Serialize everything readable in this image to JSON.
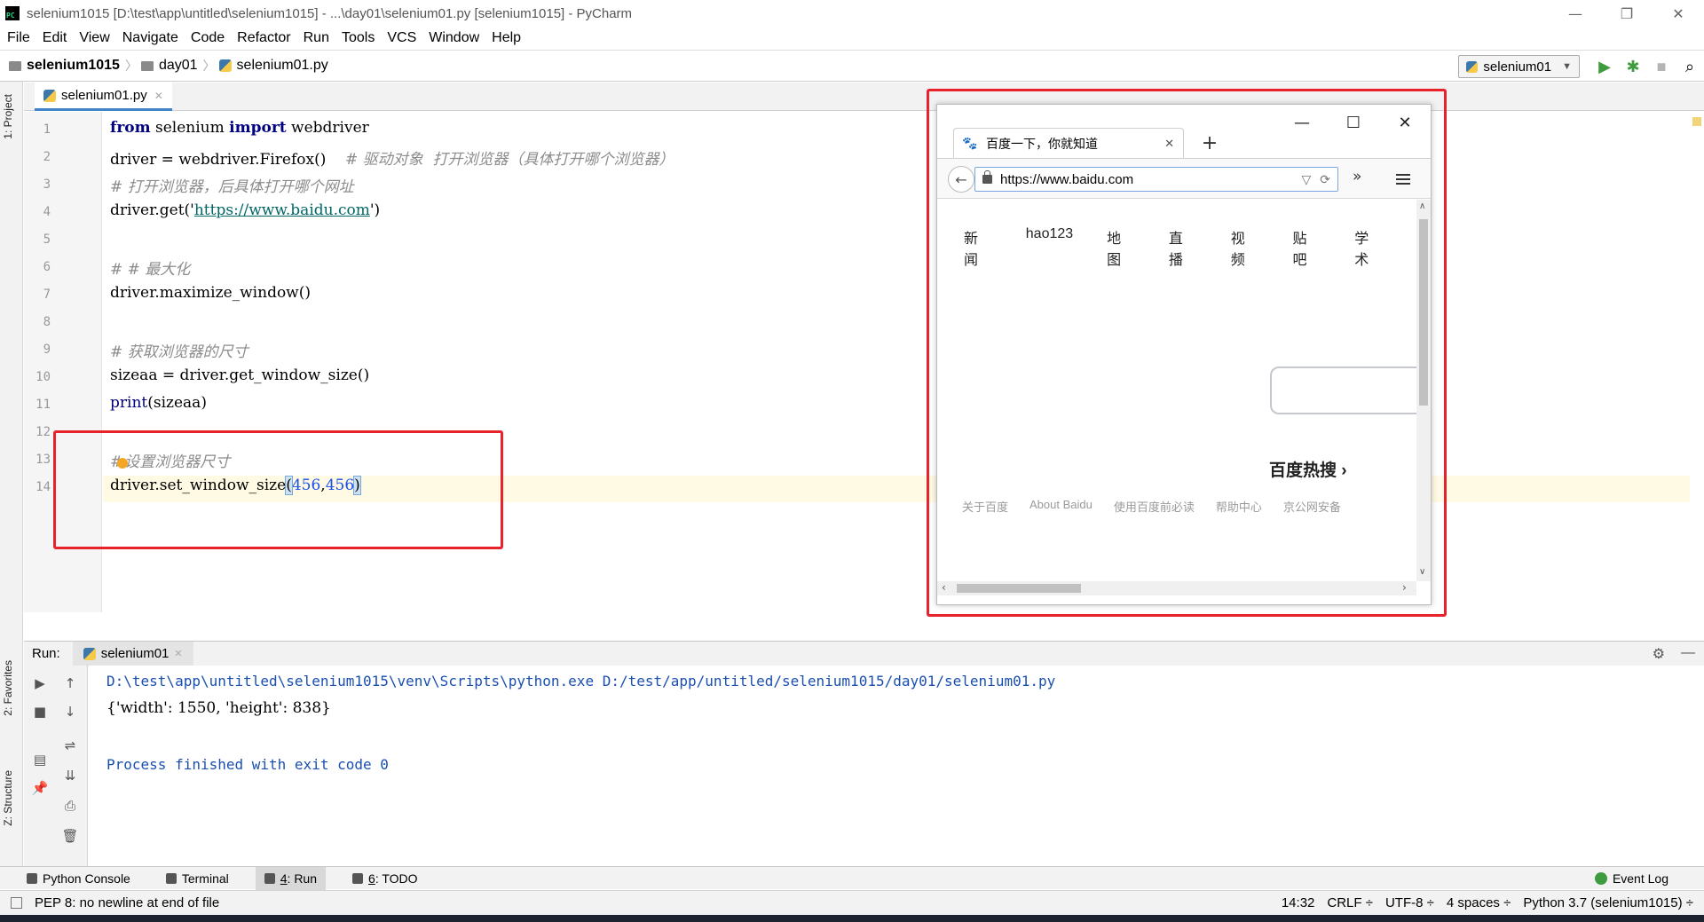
{
  "window": {
    "title": "selenium1015 [D:\\test\\app\\untitled\\selenium1015] - ...\\day01\\selenium01.py [selenium1015] - PyCharm",
    "app_icon_text": "PC",
    "min": "—",
    "max": "❐",
    "close": "✕"
  },
  "menu": [
    "File",
    "Edit",
    "View",
    "Navigate",
    "Code",
    "Refactor",
    "Run",
    "Tools",
    "VCS",
    "Window",
    "Help"
  ],
  "breadcrumb": {
    "project": "selenium1015",
    "folder": "day01",
    "file": "selenium01.py"
  },
  "toolbar": {
    "run_config": "selenium01",
    "run_icon": "▶",
    "debug_icon": "✱",
    "stop_icon": "■",
    "search_icon": "⌕"
  },
  "side_labels": {
    "project": "1: Project",
    "favorites": "2: Favorites",
    "structure": "Z: Structure"
  },
  "editor": {
    "tab_label": "selenium01.py",
    "tab_close": "✕",
    "line_numbers": [
      "1",
      "2",
      "3",
      "4",
      "5",
      "6",
      "7",
      "8",
      "9",
      "10",
      "11",
      "12",
      "13",
      "14"
    ],
    "lines": {
      "l1_kw1": "from",
      "l1_mid": " selenium ",
      "l1_kw2": "import",
      "l1_end": " webdriver",
      "l2_code": "driver = webdriver.Firefox()    ",
      "l2_comment": "# 驱动对象  打开浏览器（具体打开哪个浏览器）",
      "l3_comment": "# 打开浏览器，后具体打开哪个网址",
      "l4_start": "driver.get('",
      "l4_link": "https://www.baidu.com",
      "l4_end": "')",
      "l6_comment": "# # 最大化",
      "l7_code": "driver.maximize_window()",
      "l9_comment": "# 获取浏览器的尺寸",
      "l10_code": "sizeaa = driver.get_window_size()",
      "l11_fn": "print",
      "l11_rest": "(sizeaa)",
      "l13_hash": "#",
      "l13_comment": "设置浏览器尺寸",
      "l14_start": "driver.set_window_size",
      "l14_open": "(",
      "l14_num1": "456",
      "l14_comma": ",",
      "l14_num2": "456",
      "l14_close": ")"
    }
  },
  "firefox": {
    "tab_title": "百度一下，你就知道",
    "tab_close": "✕",
    "new_tab": "+",
    "url": "https://www.baidu.com",
    "url_dropdown": "▽",
    "reload": "⟳",
    "back": "←",
    "overflow": "»",
    "min": "—",
    "max": "☐",
    "close": "✕",
    "nav_links": [
      "新闻",
      "hao123",
      "地图",
      "直播",
      "视频",
      "贴吧",
      "学术"
    ],
    "hot_title": "百度热搜",
    "hot_arrow": "›",
    "footer_links": [
      "关于百度",
      "About Baidu",
      "使用百度前必读",
      "帮助中心",
      "京公网安备"
    ],
    "scroll_up": "∧",
    "scroll_down": "∨",
    "scroll_left": "‹",
    "scroll_right": "›"
  },
  "run_panel": {
    "label": "Run:",
    "tab": "selenium01",
    "tab_close": "✕",
    "settings_icon": "⚙",
    "hide_icon": "—",
    "output": [
      "D:\\test\\app\\untitled\\selenium1015\\venv\\Scripts\\python.exe D:/test/app/untitled/selenium1015/day01/selenium01.py",
      "{'width': 1550, 'height': 838}",
      "Process finished with exit code 0"
    ],
    "tools": {
      "rerun": "▶",
      "stop": "■",
      "up": "↑",
      "down": "↓",
      "layout": "▤",
      "wrap": "⇌",
      "pin": "📌",
      "scroll_end": "⇊",
      "print": "⎙",
      "trash": "🗑"
    }
  },
  "tool_windows": {
    "python_console": "Python Console",
    "terminal": "Terminal",
    "run_num": "4",
    "run": ": Run",
    "todo_num": "6",
    "todo": ": TODO",
    "event_log": "Event Log"
  },
  "status": {
    "message": "PEP 8: no newline at end of file",
    "position": "14:32",
    "line_sep": "CRLF ÷",
    "encoding": "UTF-8 ÷",
    "indent": "4 spaces ÷",
    "interpreter": "Python 3.7 (selenium1015) ÷"
  },
  "colors": {
    "keyword": "#000080",
    "comment": "#8c8c8c",
    "link": "#006666",
    "number": "#1750eb",
    "highlight_red": "#e8222a",
    "run_green": "#3e9b3e",
    "console_blue": "#1a4fb0"
  }
}
